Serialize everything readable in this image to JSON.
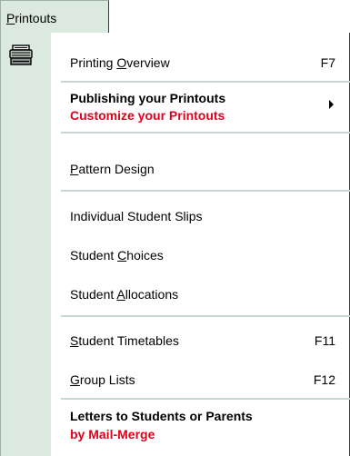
{
  "menu": {
    "title_first": "P",
    "title_rest": "rintouts"
  },
  "items": {
    "printing_overview": {
      "pre": "Printing ",
      "accel": "O",
      "post": "verview",
      "shortcut": "F7"
    },
    "publishing": {
      "line1": "Publishing your Printouts",
      "line2": "Customize your Printouts"
    },
    "pattern_design": {
      "accel": "P",
      "post": "attern Design"
    },
    "individual_slips": {
      "label": "Individual Student Slips"
    },
    "student_choices": {
      "pre": "Student ",
      "accel": "C",
      "post": "hoices"
    },
    "student_allocations": {
      "pre": "Student ",
      "accel": "A",
      "post": "llocations"
    },
    "student_timetables": {
      "accel": "S",
      "post": "tudent Timetables",
      "shortcut": "F11"
    },
    "group_lists": {
      "accel": "G",
      "post": "roup Lists",
      "shortcut": "F12"
    },
    "letters": {
      "line1": "Letters to Students or Parents",
      "line2": "by Mail-Merge"
    }
  },
  "icons": {
    "gutter_icon": "printer-icon",
    "submenu_arrow": "submenu-arrow-icon"
  },
  "colors": {
    "gutter": "#dce9e1",
    "separator": "#c7d8ce",
    "accent_red": "#e0001c"
  }
}
